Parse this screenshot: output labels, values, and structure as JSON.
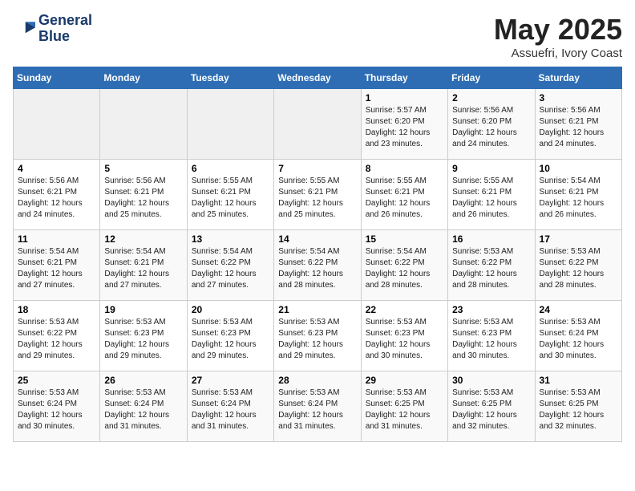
{
  "logo": {
    "line1": "General",
    "line2": "Blue"
  },
  "title": "May 2025",
  "subtitle": "Assuefri, Ivory Coast",
  "weekdays": [
    "Sunday",
    "Monday",
    "Tuesday",
    "Wednesday",
    "Thursday",
    "Friday",
    "Saturday"
  ],
  "weeks": [
    [
      {
        "day": "",
        "sunrise": "",
        "sunset": "",
        "daylight": ""
      },
      {
        "day": "",
        "sunrise": "",
        "sunset": "",
        "daylight": ""
      },
      {
        "day": "",
        "sunrise": "",
        "sunset": "",
        "daylight": ""
      },
      {
        "day": "",
        "sunrise": "",
        "sunset": "",
        "daylight": ""
      },
      {
        "day": "1",
        "sunrise": "5:57 AM",
        "sunset": "6:20 PM",
        "daylight": "12 hours and 23 minutes."
      },
      {
        "day": "2",
        "sunrise": "5:56 AM",
        "sunset": "6:20 PM",
        "daylight": "12 hours and 24 minutes."
      },
      {
        "day": "3",
        "sunrise": "5:56 AM",
        "sunset": "6:21 PM",
        "daylight": "12 hours and 24 minutes."
      }
    ],
    [
      {
        "day": "4",
        "sunrise": "5:56 AM",
        "sunset": "6:21 PM",
        "daylight": "12 hours and 24 minutes."
      },
      {
        "day": "5",
        "sunrise": "5:56 AM",
        "sunset": "6:21 PM",
        "daylight": "12 hours and 25 minutes."
      },
      {
        "day": "6",
        "sunrise": "5:55 AM",
        "sunset": "6:21 PM",
        "daylight": "12 hours and 25 minutes."
      },
      {
        "day": "7",
        "sunrise": "5:55 AM",
        "sunset": "6:21 PM",
        "daylight": "12 hours and 25 minutes."
      },
      {
        "day": "8",
        "sunrise": "5:55 AM",
        "sunset": "6:21 PM",
        "daylight": "12 hours and 26 minutes."
      },
      {
        "day": "9",
        "sunrise": "5:55 AM",
        "sunset": "6:21 PM",
        "daylight": "12 hours and 26 minutes."
      },
      {
        "day": "10",
        "sunrise": "5:54 AM",
        "sunset": "6:21 PM",
        "daylight": "12 hours and 26 minutes."
      }
    ],
    [
      {
        "day": "11",
        "sunrise": "5:54 AM",
        "sunset": "6:21 PM",
        "daylight": "12 hours and 27 minutes."
      },
      {
        "day": "12",
        "sunrise": "5:54 AM",
        "sunset": "6:21 PM",
        "daylight": "12 hours and 27 minutes."
      },
      {
        "day": "13",
        "sunrise": "5:54 AM",
        "sunset": "6:22 PM",
        "daylight": "12 hours and 27 minutes."
      },
      {
        "day": "14",
        "sunrise": "5:54 AM",
        "sunset": "6:22 PM",
        "daylight": "12 hours and 28 minutes."
      },
      {
        "day": "15",
        "sunrise": "5:54 AM",
        "sunset": "6:22 PM",
        "daylight": "12 hours and 28 minutes."
      },
      {
        "day": "16",
        "sunrise": "5:53 AM",
        "sunset": "6:22 PM",
        "daylight": "12 hours and 28 minutes."
      },
      {
        "day": "17",
        "sunrise": "5:53 AM",
        "sunset": "6:22 PM",
        "daylight": "12 hours and 28 minutes."
      }
    ],
    [
      {
        "day": "18",
        "sunrise": "5:53 AM",
        "sunset": "6:22 PM",
        "daylight": "12 hours and 29 minutes."
      },
      {
        "day": "19",
        "sunrise": "5:53 AM",
        "sunset": "6:23 PM",
        "daylight": "12 hours and 29 minutes."
      },
      {
        "day": "20",
        "sunrise": "5:53 AM",
        "sunset": "6:23 PM",
        "daylight": "12 hours and 29 minutes."
      },
      {
        "day": "21",
        "sunrise": "5:53 AM",
        "sunset": "6:23 PM",
        "daylight": "12 hours and 29 minutes."
      },
      {
        "day": "22",
        "sunrise": "5:53 AM",
        "sunset": "6:23 PM",
        "daylight": "12 hours and 30 minutes."
      },
      {
        "day": "23",
        "sunrise": "5:53 AM",
        "sunset": "6:23 PM",
        "daylight": "12 hours and 30 minutes."
      },
      {
        "day": "24",
        "sunrise": "5:53 AM",
        "sunset": "6:24 PM",
        "daylight": "12 hours and 30 minutes."
      }
    ],
    [
      {
        "day": "25",
        "sunrise": "5:53 AM",
        "sunset": "6:24 PM",
        "daylight": "12 hours and 30 minutes."
      },
      {
        "day": "26",
        "sunrise": "5:53 AM",
        "sunset": "6:24 PM",
        "daylight": "12 hours and 31 minutes."
      },
      {
        "day": "27",
        "sunrise": "5:53 AM",
        "sunset": "6:24 PM",
        "daylight": "12 hours and 31 minutes."
      },
      {
        "day": "28",
        "sunrise": "5:53 AM",
        "sunset": "6:24 PM",
        "daylight": "12 hours and 31 minutes."
      },
      {
        "day": "29",
        "sunrise": "5:53 AM",
        "sunset": "6:25 PM",
        "daylight": "12 hours and 31 minutes."
      },
      {
        "day": "30",
        "sunrise": "5:53 AM",
        "sunset": "6:25 PM",
        "daylight": "12 hours and 32 minutes."
      },
      {
        "day": "31",
        "sunrise": "5:53 AM",
        "sunset": "6:25 PM",
        "daylight": "12 hours and 32 minutes."
      }
    ]
  ]
}
